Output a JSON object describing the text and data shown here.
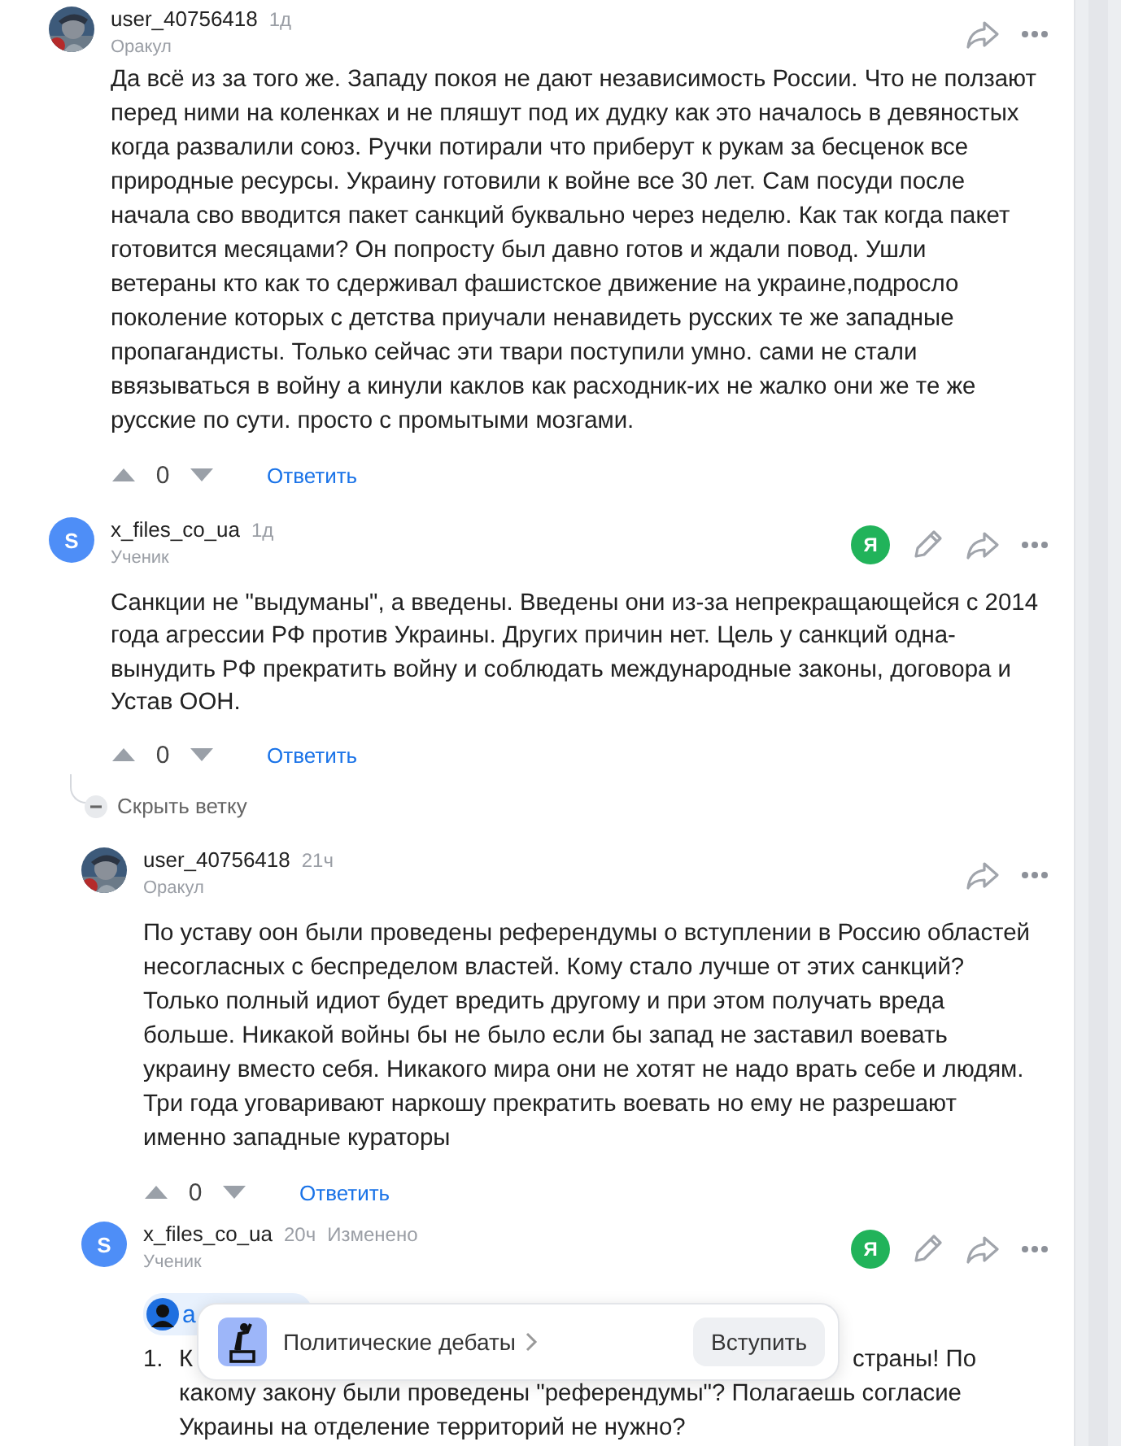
{
  "comments": [
    {
      "author": "user_40756418",
      "time": "1д",
      "rank": "Оракул",
      "avatar": {
        "kind": "picture"
      },
      "editable": false,
      "paragraphs": [
        "Да всё из за того же. Западу покоя не дают независимость России. Что не ползают перед ними на коленках и не пляшут под их дудку как это началось в девяностых когда развалили союз. Ручки потирали что приберут к рукам за бесценок все природные ресурсы. Украину готовили к войне все 30 лет. Сам посуди после начала сво вводится пакет санкций буквально через неделю. Как так когда пакет готовится месяцами? Он попросту был давно готов и ждали повод. Ушли ветераны кто как то сдерживал фашистское движение на украине,подросло поколение которых с детства приучали ненавидеть русских те же западные пропагандисты. Только сейчас эти твари поступили умно. сами не стали ввязываться в войну а кинули каклов как расходник-их не жалко они же те же русские по сути. просто с промытыми мозгами."
      ],
      "votes": {
        "score": "0",
        "reply": "Ответить"
      }
    },
    {
      "author": "x_files_co_ua",
      "time": "1д",
      "rank": "Ученик",
      "avatar": {
        "kind": "letter",
        "letter": "S",
        "color": "#4e8ef7"
      },
      "badge": "Я",
      "editable": true,
      "paragraphs": [
        "Санкции не \"выдуманы\", а введены. Введены они из-за непрекращающейся с 2014 года агрессии РФ против Украины. Других причин нет. Цель у санкций одна- вынудить РФ прекратить войну и соблюдать международные законы, договора и Устав ООН."
      ],
      "votes": {
        "score": "0",
        "reply": "Ответить"
      },
      "thread_toggle": {
        "label": "Скрыть ветку",
        "expanded": true
      },
      "replies": [
        {
          "author": "user_40756418",
          "time": "21ч",
          "rank": "Оракул",
          "avatar": {
            "kind": "picture"
          },
          "editable": false,
          "paragraphs": [
            "По уставу оон были проведены референдумы о вступлении в Россию областей несогласных с беспределом властей. Кому стало лучше от этих санкций? Только полный идиот будет вредить другому и при этом получать вреда больше. Никакой войны бы не было если бы запад не заставил воевать украину вместо себя. Никакого мира они не хотят не надо врать себе и людям. Три года уговаривают наркошу прекратить воевать но ему не разрешают именно западные кураторы"
          ],
          "votes": {
            "score": "0",
            "reply": "Ответить"
          }
        },
        {
          "author": "x_files_co_ua",
          "time": "20ч",
          "edited": "Изменено",
          "rank": "Ученик",
          "avatar": {
            "kind": "letter",
            "letter": "S",
            "color": "#4e8ef7"
          },
          "badge": "Я",
          "editable": true,
          "mention": "а",
          "list": [
            {
              "number": "1.",
              "first_line": [
                "К",
                "страны! По"
              ],
              "lines": [
                "какому закону были проведены \"референдумы\"? Полагаешь согласие",
                "Украины на отделение территорий не нужно?"
              ]
            }
          ]
        }
      ]
    }
  ],
  "popup": {
    "title": "Политические дебаты",
    "button": "Вступить"
  }
}
